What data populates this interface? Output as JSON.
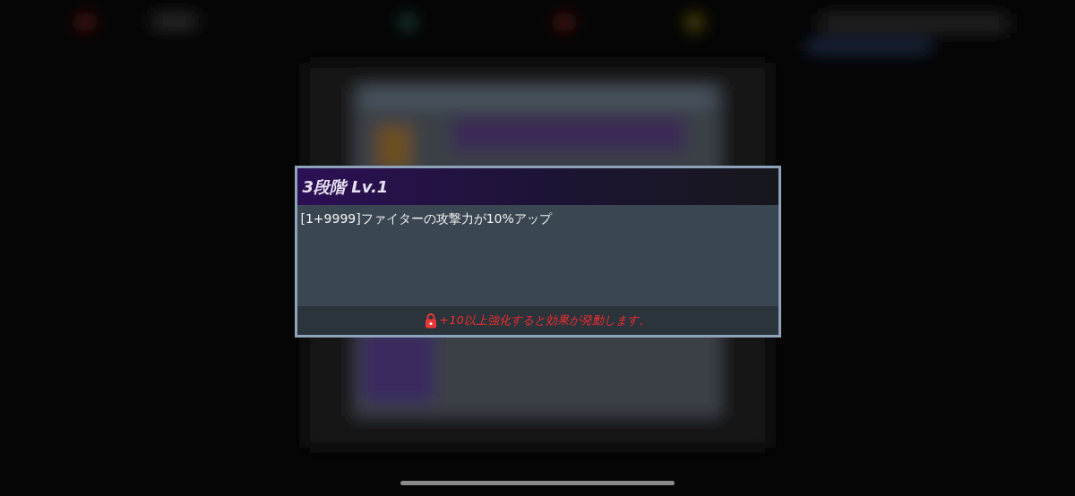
{
  "dialog": {
    "title": "3段階 Lv.1",
    "description": "[1+9999]ファイターの攻撃力が10%アップ",
    "footer": {
      "locked": true,
      "notice": "+10以上強化すると効果が発動します。"
    }
  }
}
